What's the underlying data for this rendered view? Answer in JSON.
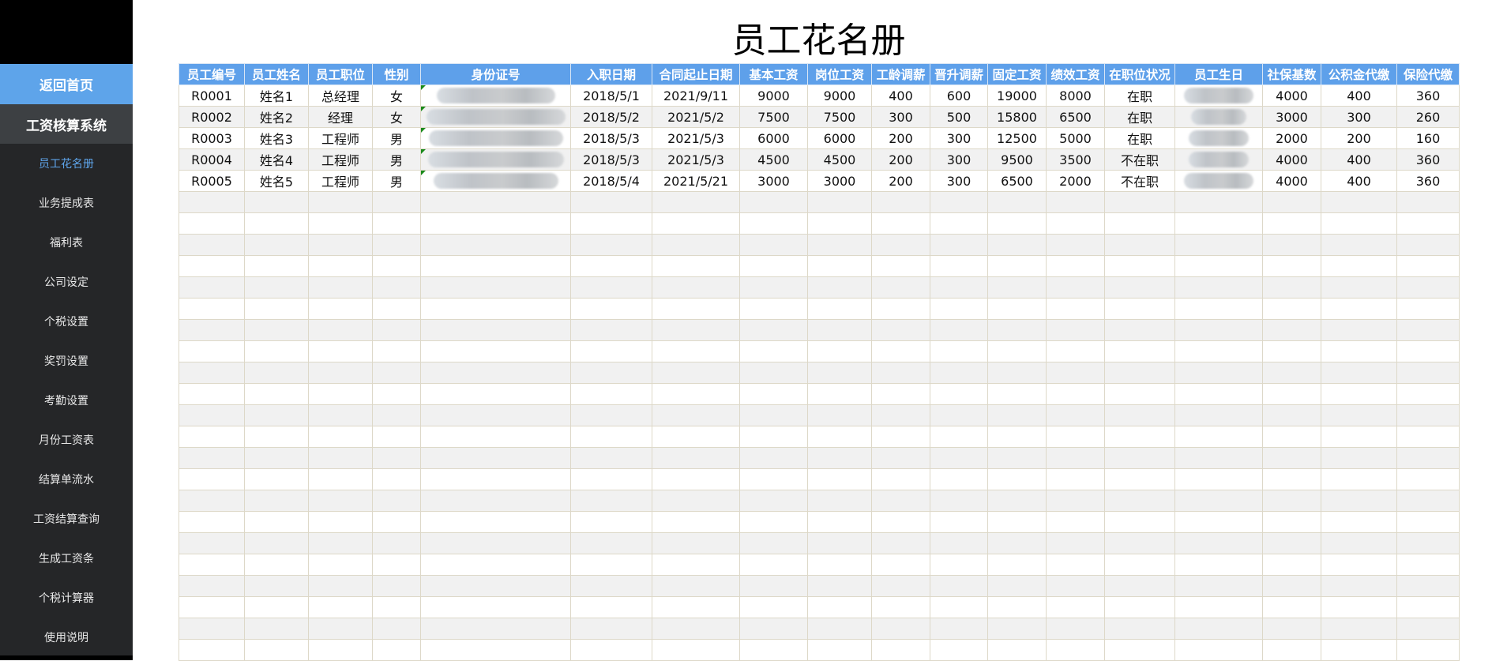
{
  "sidebar": {
    "home_label": "返回首页",
    "system_title": "工资核算系统",
    "items": [
      {
        "label": "员工花名册",
        "active": true
      },
      {
        "label": "业务提成表"
      },
      {
        "label": "福利表"
      },
      {
        "label": "公司设定"
      },
      {
        "label": "个税设置"
      },
      {
        "label": "奖罚设置"
      },
      {
        "label": "考勤设置"
      },
      {
        "label": "月份工资表"
      },
      {
        "label": "结算单流水"
      },
      {
        "label": "工资结算查询"
      },
      {
        "label": "生成工资条"
      },
      {
        "label": "个税计算器"
      },
      {
        "label": "使用说明"
      }
    ]
  },
  "page": {
    "title": "员工花名册"
  },
  "table": {
    "headers": [
      "员工编号",
      "员工姓名",
      "员工职位",
      "性别",
      "身份证号",
      "入职日期",
      "合同起止日期",
      "基本工资",
      "岗位工资",
      "工龄调薪",
      "晋升调薪",
      "固定工资",
      "绩效工资",
      "在职位状况",
      "员工生日",
      "社保基数",
      "公积金代缴",
      "保险代缴"
    ],
    "rows": [
      [
        "R0001",
        "姓名1",
        "总经理",
        "女",
        "[redacted]",
        "2018/5/1",
        "2021/9/11",
        "9000",
        "9000",
        "400",
        "600",
        "19000",
        "8000",
        "在职",
        "[redacted]",
        "4000",
        "400",
        "360"
      ],
      [
        "R0002",
        "姓名2",
        "经理",
        "女",
        "[redacted]",
        "2018/5/2",
        "2021/5/2",
        "7500",
        "7500",
        "300",
        "500",
        "15800",
        "6500",
        "在职",
        "[redacted]",
        "3000",
        "300",
        "260"
      ],
      [
        "R0003",
        "姓名3",
        "工程师",
        "男",
        "[redacted]",
        "2018/5/3",
        "2021/5/3",
        "6000",
        "6000",
        "200",
        "300",
        "12500",
        "5000",
        "在职",
        "[redacted]",
        "2000",
        "200",
        "160"
      ],
      [
        "R0004",
        "姓名4",
        "工程师",
        "男",
        "[redacted]",
        "2018/5/3",
        "2021/5/3",
        "4500",
        "4500",
        "200",
        "300",
        "9500",
        "3500",
        "不在职",
        "[redacted]",
        "4000",
        "400",
        "360"
      ],
      [
        "R0005",
        "姓名5",
        "工程师",
        "男",
        "[redacted]",
        "2018/5/4",
        "2021/5/21",
        "3000",
        "3000",
        "200",
        "300",
        "6500",
        "2000",
        "不在职",
        "[redacted]",
        "4000",
        "400",
        "360"
      ]
    ],
    "empty_rows": 22,
    "colors": {
      "header_bg": "#5ea0ea",
      "grid_line": "#ddd8c8",
      "alt_row": "#f1f1f1"
    }
  }
}
